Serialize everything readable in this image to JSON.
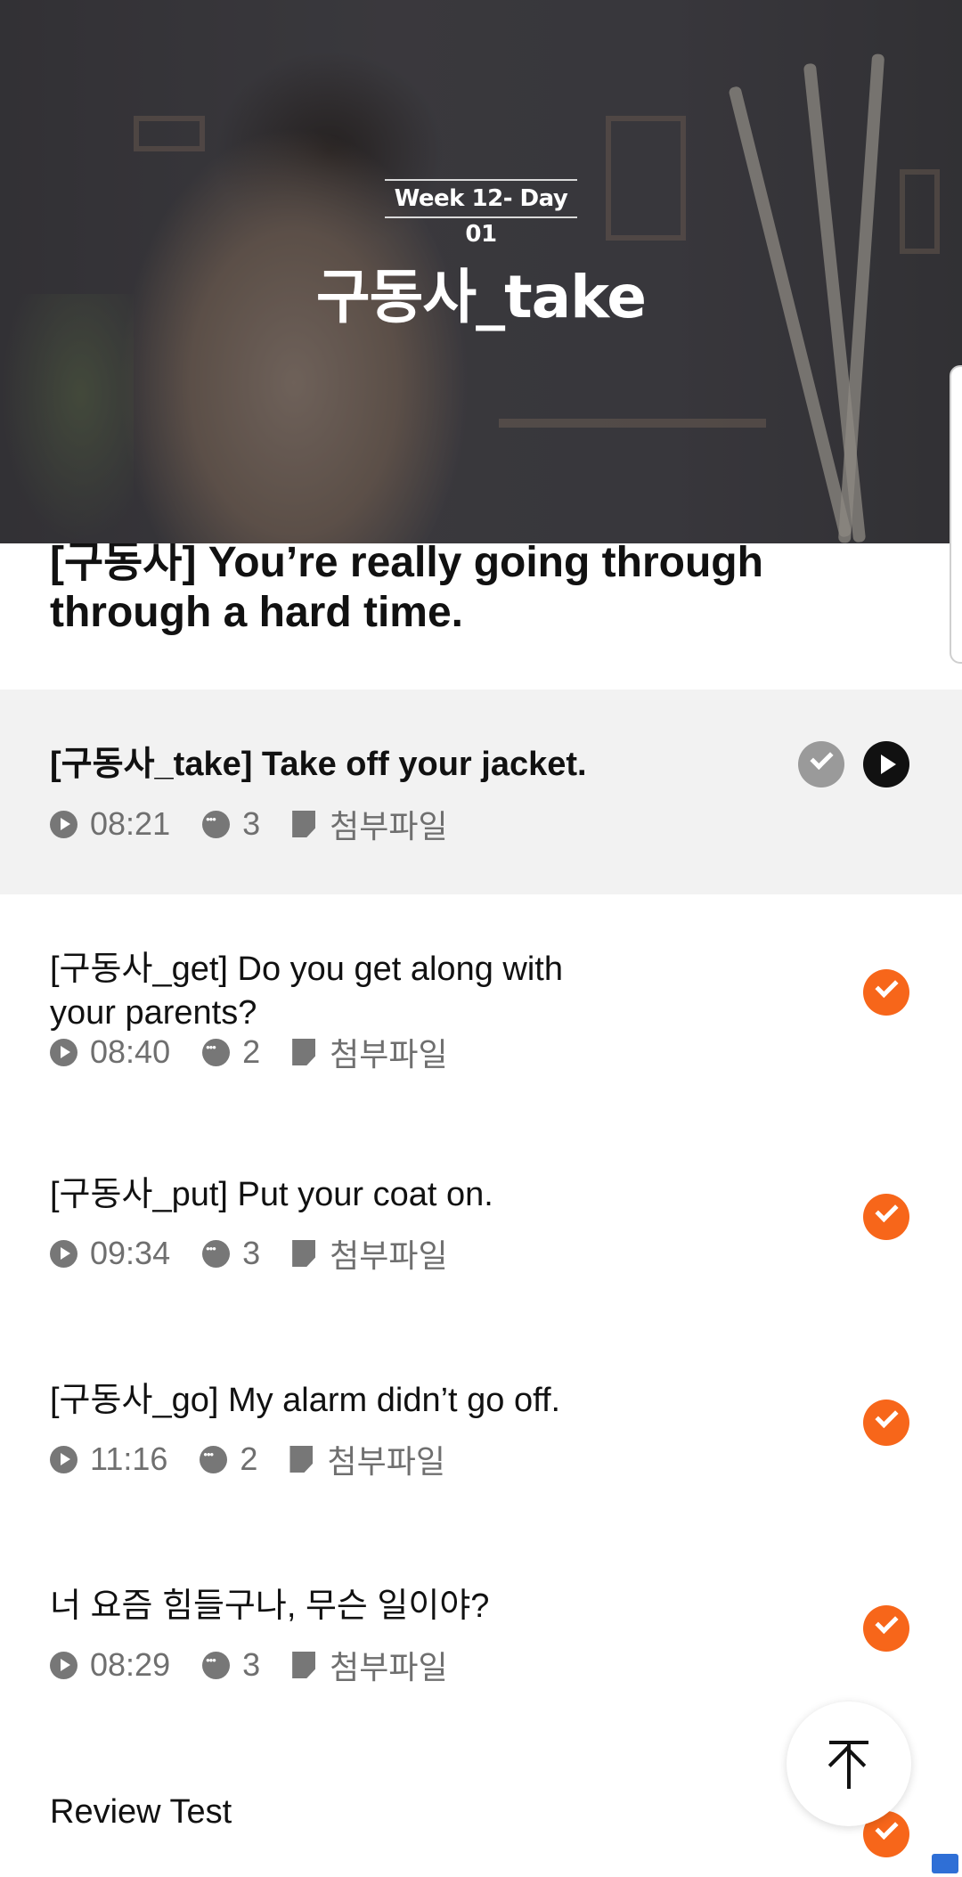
{
  "hero": {
    "week_label": "Week 12- Day 01",
    "title": "구동사_take"
  },
  "lesson": {
    "title_line1": "[구동사] You’re really going through",
    "title_line2": "through a hard time."
  },
  "colors": {
    "accent": "#f7661a",
    "active_row_bg": "#f2f2f2",
    "meta_text": "#6f6f6f"
  },
  "items": [
    {
      "title": "[구동사_take] Take off your jacket.",
      "duration": "08:21",
      "comments": "3",
      "attachment": "첨부파일",
      "status": "current"
    },
    {
      "title": "[구동사_get] Do you get along with your parents?",
      "duration": "08:40",
      "comments": "2",
      "attachment": "첨부파일",
      "status": "completed"
    },
    {
      "title": "[구동사_put] Put your coat on.",
      "duration": "09:34",
      "comments": "3",
      "attachment": "첨부파일",
      "status": "completed"
    },
    {
      "title": "[구동사_go] My alarm didn’t go off.",
      "duration": "11:16",
      "comments": "2",
      "attachment": "첨부파일",
      "status": "completed"
    },
    {
      "title": "너 요즘 힘들구나, 무슨 일이야?",
      "duration": "08:29",
      "comments": "3",
      "attachment": "첨부파일",
      "status": "completed"
    },
    {
      "title": "Review Test",
      "status": "completed"
    }
  ],
  "icons": {
    "duration": "play-circle-icon",
    "comments": "chat-bubble-icon",
    "attachment": "file-icon",
    "completed": "check-circle-icon",
    "play": "play-circle-icon",
    "scroll_top": "arrow-up-to-top-icon"
  }
}
